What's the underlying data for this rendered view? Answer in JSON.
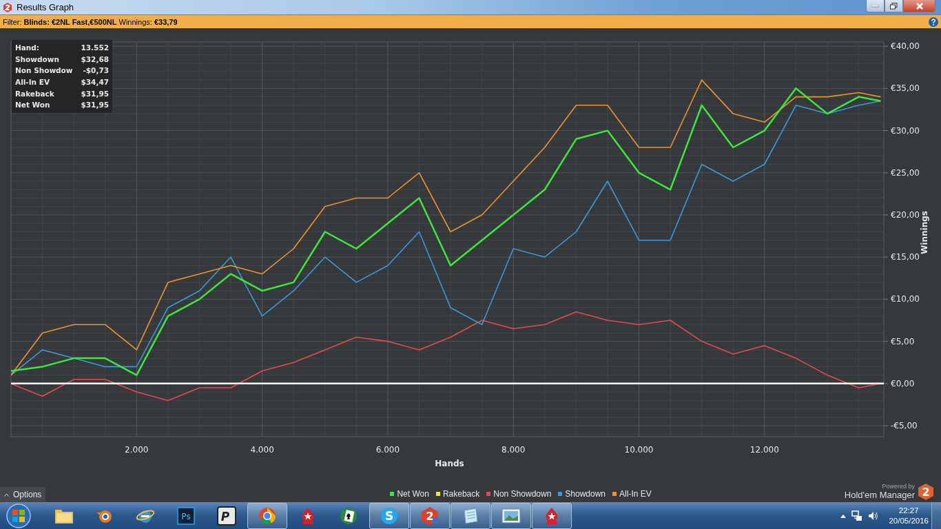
{
  "window": {
    "title": "Results Graph"
  },
  "filter_bar": {
    "text": "Filter: **Blinds: €2NL Fast,€500NL** Winnings: **€33,79**"
  },
  "tooltip": {
    "rows": [
      {
        "label": "Hand:",
        "value": "13.552"
      },
      {
        "label": "Showdown",
        "value": "$32,68"
      },
      {
        "label": "Non Showdow",
        "value": "-$0,73"
      },
      {
        "label": "All-In EV",
        "value": "$34,47"
      },
      {
        "label": "Rakeback",
        "value": "$31,95"
      },
      {
        "label": "Net Won",
        "value": "$31,95"
      }
    ]
  },
  "chart": {
    "chart_data": {
      "type": "line",
      "grid": true,
      "xlabel": "Hands",
      "ylabel": "Winnings",
      "xlim": [
        0,
        13900
      ],
      "ylim": [
        -6.3,
        40.5
      ],
      "xticks": [
        {
          "value": 2000,
          "label": "2.000"
        },
        {
          "value": 4000,
          "label": "4.000"
        },
        {
          "value": 6000,
          "label": "6.000"
        },
        {
          "value": 8000,
          "label": "8.000"
        },
        {
          "value": 10000,
          "label": "10.000"
        },
        {
          "value": 12000,
          "label": "12.000"
        }
      ],
      "yticks": [
        {
          "value": 40,
          "label": "€40,00"
        },
        {
          "value": 35,
          "label": "€35,00"
        },
        {
          "value": 30,
          "label": "€30,00"
        },
        {
          "value": 25,
          "label": "€25,00"
        },
        {
          "value": 20,
          "label": "€20,00"
        },
        {
          "value": 15,
          "label": "€15,00"
        },
        {
          "value": 10,
          "label": "€10,00"
        },
        {
          "value": 5,
          "label": "€5,00"
        },
        {
          "value": 0,
          "label": "€0,00"
        },
        {
          "value": -5,
          "label": "-€5,00"
        }
      ],
      "x": [
        0,
        500,
        1000,
        1500,
        2000,
        2500,
        3000,
        3500,
        4000,
        4500,
        5000,
        5500,
        6000,
        6500,
        7000,
        7500,
        8000,
        8500,
        9000,
        9500,
        10000,
        10500,
        11000,
        11500,
        12000,
        12500,
        13000,
        13500,
        13850
      ],
      "series": [
        {
          "name": "Net Won",
          "color": "#3ee83a",
          "values": [
            1.5,
            2,
            3,
            3,
            1,
            8,
            10,
            13,
            11,
            12,
            18,
            16,
            19,
            22,
            14,
            17,
            20,
            23,
            29,
            30,
            25,
            23,
            33,
            28,
            30,
            35,
            32,
            34,
            33.5
          ]
        },
        {
          "name": "Rakeback",
          "color": "#e8e83a",
          "values": [
            null,
            null,
            null,
            null,
            null,
            null,
            null,
            null,
            null,
            null,
            null,
            null,
            null,
            null,
            null,
            null,
            null,
            null,
            null,
            null,
            null,
            null,
            null,
            null,
            null,
            null,
            null,
            null,
            null
          ]
        },
        {
          "name": "Non Showdown",
          "color": "#e84a4a",
          "values": [
            0,
            -1.5,
            0.5,
            0.5,
            -1,
            -2,
            -0.5,
            -0.5,
            1.5,
            2.5,
            4,
            5.5,
            5,
            4,
            5.5,
            7.5,
            6.5,
            7,
            8.5,
            7.5,
            7,
            7.5,
            5,
            3.5,
            4.5,
            3,
            1,
            -0.5,
            0
          ]
        },
        {
          "name": "Showdown",
          "color": "#3a9ad9",
          "values": [
            1,
            4,
            3,
            2,
            2,
            9,
            11,
            15,
            8,
            11,
            15,
            12,
            14,
            18,
            9,
            7,
            16,
            15,
            18,
            24,
            17,
            17,
            26,
            24,
            26,
            33,
            32,
            33,
            33.5
          ]
        },
        {
          "name": "All-In EV",
          "color": "#f2912e",
          "values": [
            1,
            6,
            7,
            7,
            4,
            12,
            13,
            14,
            13,
            16,
            21,
            22,
            22,
            25,
            18,
            20,
            24,
            28,
            33,
            33,
            28,
            28,
            36,
            32,
            31,
            34,
            34,
            34.5,
            34
          ]
        }
      ]
    }
  },
  "options_button": {
    "label": "Options"
  },
  "branding": {
    "powered_by": "Powered by",
    "product": "Hold'em Manager",
    "logo": "2"
  },
  "taskbar": {
    "apps": [
      {
        "kind": "folder",
        "open": false
      },
      {
        "kind": "blender",
        "open": false
      },
      {
        "kind": "browser",
        "open": false
      },
      {
        "kind": "ps",
        "open": false,
        "label": "Ps"
      },
      {
        "kind": "px",
        "open": false,
        "label": "P"
      },
      {
        "kind": "chrome",
        "open": true
      },
      {
        "kind": "star",
        "open": false
      },
      {
        "kind": "cards",
        "open": false
      },
      {
        "kind": "skype",
        "open": true,
        "label": "S"
      },
      {
        "kind": "hm",
        "open": true,
        "label": "2"
      },
      {
        "kind": "notepad",
        "open": true
      },
      {
        "kind": "photos",
        "open": true
      },
      {
        "kind": "star",
        "open": true
      }
    ],
    "time": "22:27",
    "date": "20/05/2016"
  }
}
